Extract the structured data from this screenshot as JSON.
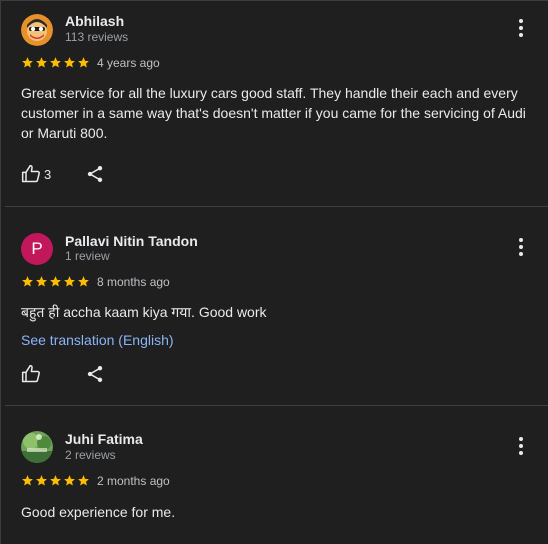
{
  "reviews": [
    {
      "name": "Abhilash",
      "review_count": "113 reviews",
      "rating": 5,
      "time": "4 years ago",
      "text": "Great service for all the luxury cars good staff. They handle their each and every customer in a same way that's doesn't matter if you came for the servicing of Audi or Maruti 800.",
      "likes": "3",
      "avatar": "cartoon-photo"
    },
    {
      "name": "Pallavi Nitin Tandon",
      "review_count": "1 review",
      "rating": 5,
      "time": "8 months ago",
      "text": "बहुत ही accha kaam kiya गया. Good work",
      "translate_label": "See translation (English)",
      "avatar_letter": "P",
      "avatar_color": "#c2185b"
    },
    {
      "name": "Juhi Fatima",
      "review_count": "2 reviews",
      "rating": 5,
      "time": "2 months ago",
      "text": "Good experience for me.",
      "avatar": "nature-photo"
    }
  ],
  "colors": {
    "background": "#1f1f1f",
    "star": "#fbbc04",
    "link": "#8ab4f8",
    "divider": "#3c4043"
  },
  "icons": [
    "more-vert-icon",
    "thumb-up-icon",
    "share-icon",
    "star-icon"
  ]
}
